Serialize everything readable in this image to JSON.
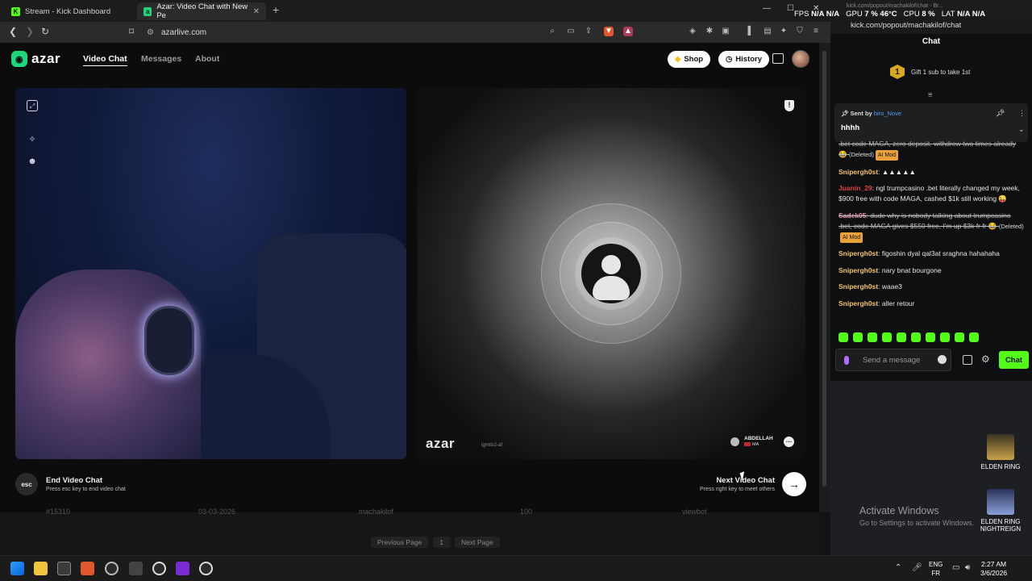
{
  "browser": {
    "tabs": [
      {
        "label": "Stream - Kick Dashboard",
        "active": false
      },
      {
        "label": "Azar: Video Chat with New Pe",
        "active": true
      }
    ],
    "url": "azarlive.com"
  },
  "azar": {
    "logo": "azar",
    "nav": {
      "video_chat": "Video Chat",
      "messages": "Messages",
      "about": "About"
    },
    "shop_label": "Shop",
    "history_label": "History",
    "watermark": "azar",
    "watermark_sub": "lgmtls2-af",
    "peer": {
      "name": "ABDELLAH",
      "country": "MA"
    },
    "end_chat": {
      "key": "esc",
      "title": "End Video Chat",
      "subtitle": "Press esc key to end video chat"
    },
    "next_chat": {
      "title": "Next Video Chat",
      "subtitle": "Press right key to meet others"
    }
  },
  "background_page": {
    "row": [
      "#15310",
      "03-03-2026",
      "machakilof",
      "100",
      "viewbot"
    ],
    "pager": {
      "prev": "Previous Page",
      "page": "1",
      "next": "Next Page"
    }
  },
  "kick": {
    "title_bar": "kick.com/popout/machakilof/chat - Br...",
    "address": "kick.com/popout/machakilof/chat",
    "overlay": {
      "fps_label": "FPS",
      "fps": "N/A",
      "fps2": "N/A",
      "gpu_label": "GPU",
      "gpu": "7 %",
      "gpu_temp": "46°C",
      "cpu_label": "CPU",
      "cpu": "8 %",
      "lat_label": "LAT",
      "lat": "N/A",
      "lat2": "N/A"
    },
    "chat_title": "Chat",
    "gift": {
      "count": "1",
      "text": "Gift 1 sub to take 1st"
    },
    "pinned": {
      "sent_by": "Sent by",
      "user": "biro_Nove",
      "message": "hhhh"
    },
    "messages": [
      {
        "user": "",
        "text": ".bet code MAGA, zero deposit. withdrew two times already 😂",
        "deleted": true,
        "note": "(Deleted)",
        "tag": "AI Mod",
        "color": "#ffffff"
      },
      {
        "user": "Snipergh0st",
        "text": "▲▲▲▲▲",
        "deleted": false,
        "note": "",
        "tag": "",
        "color": "#f4c36b"
      },
      {
        "user": "Juanin_29",
        "text": "ngl trumpcasino .bet literally changed my week, $900 free with code MAGA, cashed $1k still working 😜",
        "deleted": false,
        "note": "",
        "tag": "",
        "color": "#e0433e"
      },
      {
        "user": "Sadek05",
        "text": "dude why is nobody talking about trumpcasino .bet, code MAGA gives $550 free, I'm up $3k fr fr 😂",
        "deleted": true,
        "note": "(Deleted)",
        "tag": "AI Mod",
        "color": "#f49ab0"
      },
      {
        "user": "Snipergh0st",
        "text": "figoshin dyal qal3at sraghna hahahaha",
        "deleted": false,
        "note": "",
        "tag": "",
        "color": "#f4c36b"
      },
      {
        "user": "Snipergh0st",
        "text": "nary bnat bourgone",
        "deleted": false,
        "note": "",
        "tag": "",
        "color": "#f4c36b"
      },
      {
        "user": "Snipergh0st",
        "text": "waae3",
        "deleted": false,
        "note": "",
        "tag": "",
        "color": "#f4c36b"
      },
      {
        "user": "Snipergh0st",
        "text": "aller retour",
        "deleted": false,
        "note": "",
        "tag": "",
        "color": "#f4c36b"
      }
    ],
    "input_placeholder": "Send a message",
    "chat_button": "Chat"
  },
  "desktop": {
    "icons": [
      {
        "label": "ELDEN RING"
      },
      {
        "label": "ELDEN RING NIGHTREIGN"
      }
    ],
    "activate_title": "Activate Windows",
    "activate_sub": "Go to Settings to activate Windows."
  },
  "taskbar": {
    "lang1": "ENG",
    "lang2": "FR",
    "time": "2:27 AM",
    "date": "3/6/2026"
  }
}
